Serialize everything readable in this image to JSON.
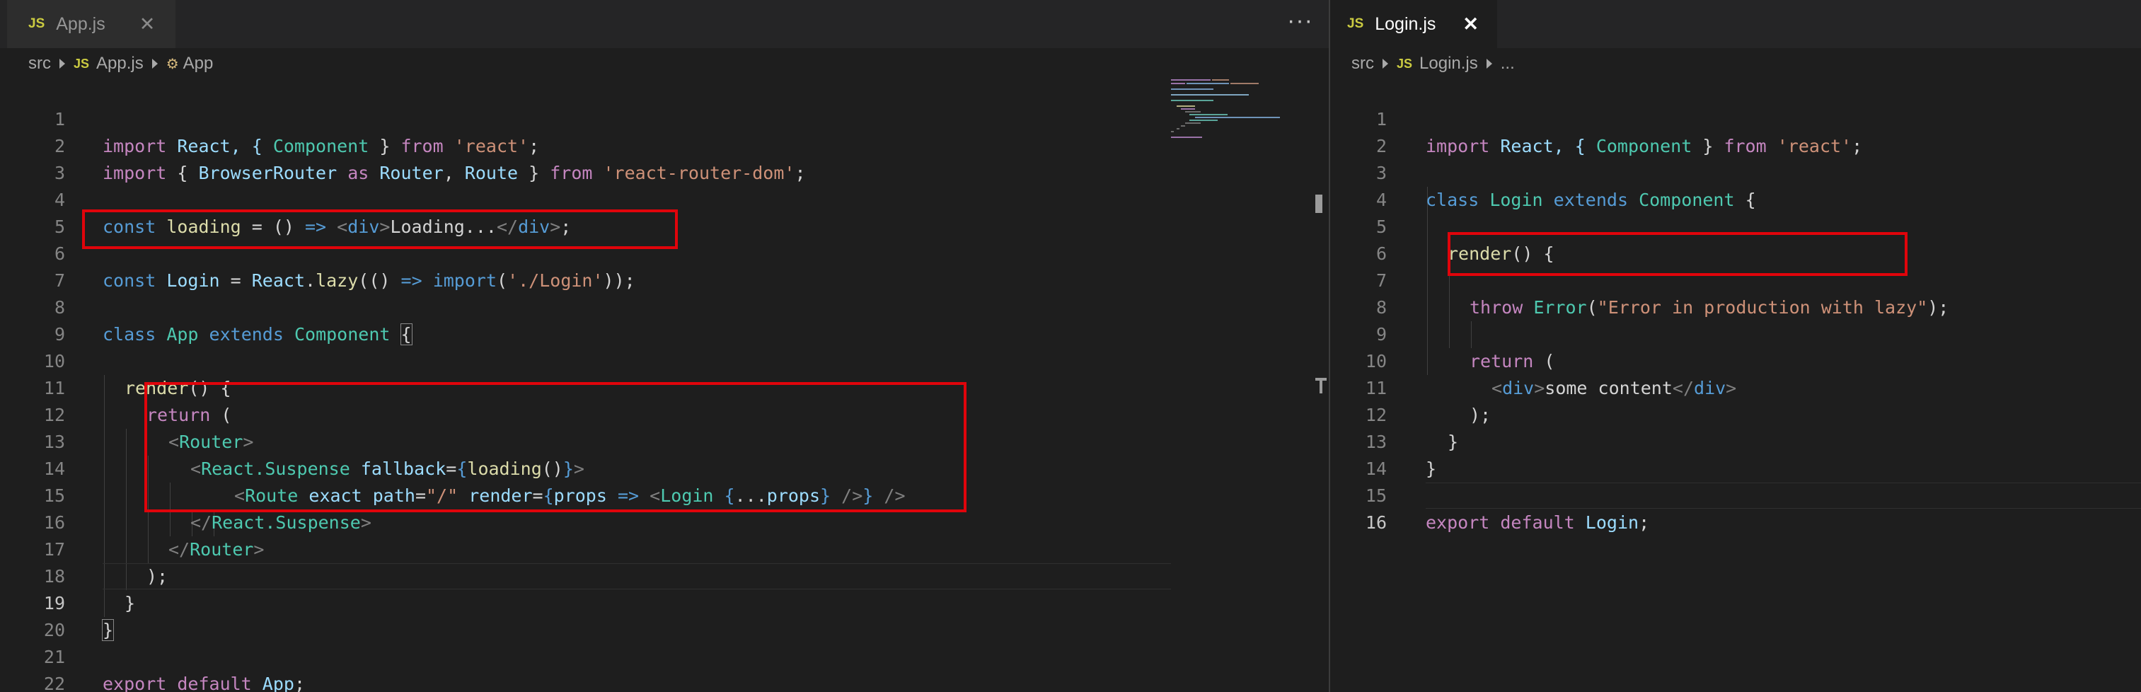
{
  "left_editor": {
    "tab": {
      "badge": "JS",
      "label": "App.js",
      "close": "✕"
    },
    "more_actions": "···",
    "breadcrumb": {
      "folder": "src",
      "file_badge": "JS",
      "file": "App.js",
      "symbol_icon": "⚙",
      "symbol": "App"
    },
    "lines": [
      {
        "n": "1"
      },
      {
        "n": "2"
      },
      {
        "n": "3"
      },
      {
        "n": "4"
      },
      {
        "n": "5"
      },
      {
        "n": "6"
      },
      {
        "n": "7"
      },
      {
        "n": "8"
      },
      {
        "n": "9"
      },
      {
        "n": "10"
      },
      {
        "n": "11"
      },
      {
        "n": "12"
      },
      {
        "n": "13"
      },
      {
        "n": "14"
      },
      {
        "n": "15"
      },
      {
        "n": "16"
      },
      {
        "n": "17"
      },
      {
        "n": "18"
      },
      {
        "n": "19"
      },
      {
        "n": "20"
      },
      {
        "n": "21"
      },
      {
        "n": "22"
      }
    ],
    "code": {
      "l1": [
        "import",
        " React, { ",
        "Component",
        " } ",
        "from",
        " ",
        "'react'",
        ";"
      ],
      "l2": [
        "import",
        " { ",
        "BrowserRouter",
        " ",
        "as",
        " ",
        "Router",
        ", ",
        "Route",
        " } ",
        "from",
        " ",
        "'react-router-dom'",
        ";"
      ],
      "l4": [
        "const",
        " ",
        "loading",
        " = () ",
        "=>",
        " ",
        "<",
        "div",
        ">",
        "Loading...",
        "</",
        "div",
        ">",
        ";"
      ],
      "l6": [
        "const",
        " ",
        "Login",
        " = ",
        "React",
        ".",
        "lazy",
        "(() ",
        "=>",
        " ",
        "import",
        "(",
        "'./Login'",
        "));"
      ],
      "l8": [
        "class",
        " ",
        "App",
        " ",
        "extends",
        " ",
        "Component",
        " ",
        "{"
      ],
      "l10": [
        "render",
        "() {"
      ],
      "l11": [
        "return",
        " ("
      ],
      "l12": [
        "<",
        "Router",
        ">"
      ],
      "l13": [
        "<",
        "React.Suspense",
        " ",
        "fallback",
        "=",
        "{",
        "loading",
        "()",
        "}",
        ">"
      ],
      "l14": [
        "<",
        "Route",
        " ",
        "exact",
        " ",
        "path",
        "=",
        "\"/\"",
        " ",
        "render",
        "=",
        "{",
        "props",
        " ",
        "=>",
        " ",
        "<",
        "Login",
        " ",
        "{",
        "...",
        "props",
        "}",
        " ",
        "/>",
        "}",
        " ",
        "/>"
      ],
      "l15": [
        "</",
        "React.Suspense",
        ">"
      ],
      "l16": [
        "</",
        "Router",
        ">"
      ],
      "l17": [
        ");"
      ],
      "l18": [
        "}"
      ],
      "l19": [
        "}"
      ],
      "l21": [
        "export",
        " ",
        "default",
        " ",
        "App",
        ";"
      ]
    }
  },
  "right_editor": {
    "tab": {
      "badge": "JS",
      "label": "Login.js",
      "close": "✕"
    },
    "breadcrumb": {
      "folder": "src",
      "file_badge": "JS",
      "file": "Login.js",
      "symbol": "..."
    },
    "lines": [
      {
        "n": "1"
      },
      {
        "n": "2"
      },
      {
        "n": "3"
      },
      {
        "n": "4"
      },
      {
        "n": "5"
      },
      {
        "n": "6"
      },
      {
        "n": "7"
      },
      {
        "n": "8"
      },
      {
        "n": "9"
      },
      {
        "n": "10"
      },
      {
        "n": "11"
      },
      {
        "n": "12"
      },
      {
        "n": "13"
      },
      {
        "n": "14"
      },
      {
        "n": "15"
      },
      {
        "n": "16"
      }
    ],
    "code": {
      "l1": [
        "import",
        " React, { ",
        "Component",
        " } ",
        "from",
        " ",
        "'react'",
        ";"
      ],
      "l3": [
        "class",
        " ",
        "Login",
        " ",
        "extends",
        " ",
        "Component",
        " {"
      ],
      "l5": [
        "render",
        "() {"
      ],
      "l7": [
        "throw",
        " ",
        "Error",
        "(",
        "\"Error in production with lazy\"",
        ");"
      ],
      "l9": [
        "return",
        " ("
      ],
      "l10": [
        "<",
        "div",
        ">",
        "some content",
        "</",
        "div",
        ">"
      ],
      "l11": [
        ");"
      ],
      "l12": [
        "}"
      ],
      "l13": [
        "}"
      ],
      "l15": [
        "export",
        " ",
        "default",
        " ",
        "Login",
        ";"
      ]
    }
  },
  "colors": {
    "background": "#1e1e1e",
    "highlight_box": "#e0040b",
    "keyword": "#569cd6",
    "control": "#c586c0",
    "string": "#ce9178",
    "function": "#dcdcaa",
    "class": "#4ec9b0",
    "variable": "#9cdcfe"
  }
}
